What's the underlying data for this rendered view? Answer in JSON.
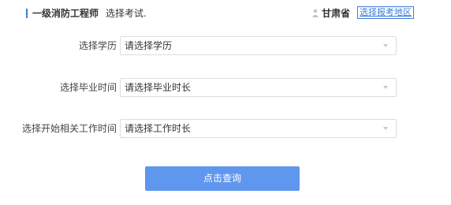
{
  "header": {
    "exam_name": "一级消防工程师",
    "subtitle": "选择考试.",
    "province": "甘肃省",
    "region_link": "选择报考地区",
    "user_icon": "user-icon",
    "accent_color": "#3d7bd8"
  },
  "form": {
    "education": {
      "label": "选择学历",
      "value": "请选择学历"
    },
    "graduation": {
      "label": "选择毕业时间",
      "value": "请选择毕业时长"
    },
    "work_start": {
      "label": "选择开始相关工作时间",
      "value": "请选择工作时长"
    }
  },
  "actions": {
    "query_label": "点击查询",
    "button_color": "#5f97ee"
  }
}
